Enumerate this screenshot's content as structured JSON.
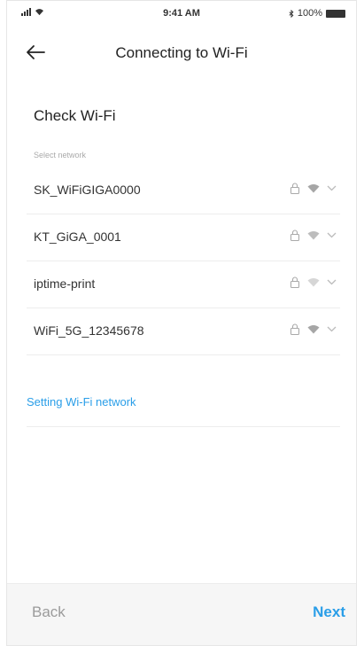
{
  "status_bar": {
    "time": "9:41 AM",
    "battery": "100%"
  },
  "header": {
    "title": "Connecting to Wi-Fi"
  },
  "main": {
    "section_title": "Check Wi-Fi",
    "section_subtitle": "Select network",
    "networks": [
      {
        "name": "SK_WiFiGIGA0000"
      },
      {
        "name": "KT_GiGA_0001"
      },
      {
        "name": "iptime-print"
      },
      {
        "name": "WiFi_5G_12345678"
      }
    ],
    "setting_link": "Setting Wi-Fi network"
  },
  "footer": {
    "back_label": "Back",
    "next_label": "Next"
  },
  "colors": {
    "accent": "#2a9ee8",
    "muted": "#9b9b9b"
  }
}
